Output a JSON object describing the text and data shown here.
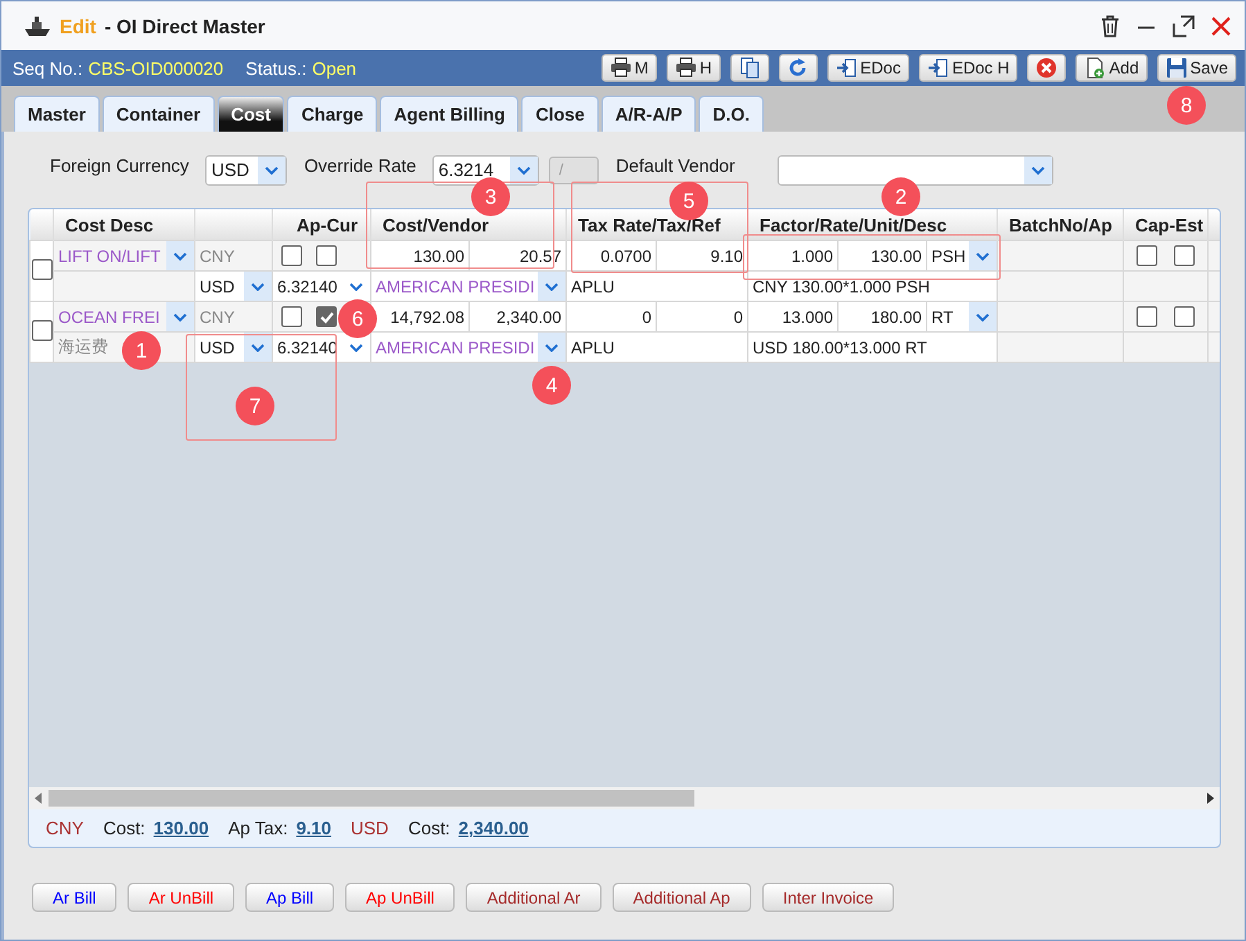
{
  "window": {
    "mode": "Edit",
    "title": "- OI Direct Master"
  },
  "info_bar": {
    "fields": [
      {
        "label": "Seq No.:",
        "value": "CBS-OID000020"
      },
      {
        "label": "Status.:",
        "value": "Open"
      }
    ],
    "buttons": [
      {
        "kind": "print",
        "label": "M"
      },
      {
        "kind": "print",
        "label": "H"
      },
      {
        "kind": "copy"
      },
      {
        "kind": "refresh"
      },
      {
        "kind": "import",
        "label": "EDoc"
      },
      {
        "kind": "import",
        "label": "EDoc H"
      },
      {
        "kind": "delete"
      },
      {
        "kind": "add",
        "label": "Add"
      },
      {
        "kind": "save",
        "label": "Save"
      }
    ]
  },
  "tabs": [
    {
      "label": "Master",
      "selected": false
    },
    {
      "label": "Container",
      "selected": false
    },
    {
      "label": "Cost",
      "selected": true
    },
    {
      "label": "Charge",
      "selected": false
    },
    {
      "label": "Agent Billing",
      "selected": false
    },
    {
      "label": "Close",
      "selected": false
    },
    {
      "label": "A/R-A/P",
      "selected": false
    },
    {
      "label": "D.O.",
      "selected": false
    }
  ],
  "form": {
    "foreign_currency": {
      "label": "Foreign Currency",
      "value": "USD"
    },
    "override_rate": {
      "label": "Override Rate",
      "value": "6.3214",
      "extra": "/"
    },
    "default_vendor": {
      "label": "Default Vendor"
    }
  },
  "table": {
    "columns": [
      "Cost Desc",
      "Ap-Cur",
      "Cost/Vendor",
      "Tax Rate/Tax/Ref",
      "Factor/Rate/Unit/Desc",
      "BatchNo/Ap",
      "Cap-Est"
    ],
    "rows": [
      {
        "selected": false,
        "cost_desc": "LIFT ON/LIFT",
        "local_name": "",
        "currency": "CNY",
        "check_1": false,
        "check_2": false,
        "ap_currency": "USD",
        "rate": "6.32140",
        "cost": "130.00",
        "amount": "20.57",
        "vendor": "AMERICAN PRESIDI",
        "tax_rate": "0.0700",
        "tax": "9.10",
        "ref": "APLU",
        "factor": "1.000",
        "unit_rate": "130.00",
        "unit": "PSH",
        "desc": "CNY 130.00*1.000 PSH",
        "cap": false,
        "est": false
      },
      {
        "selected": false,
        "cost_desc": "OCEAN FREI",
        "local_name": "海运费",
        "currency": "CNY",
        "check_1": false,
        "check_2": true,
        "ap_currency": "USD",
        "rate": "6.32140",
        "cost": "14,792.08",
        "amount": "2,340.00",
        "vendor": "AMERICAN PRESIDI",
        "tax_rate": "0",
        "tax": "0",
        "ref": "APLU",
        "factor": "13.000",
        "unit_rate": "180.00",
        "unit": "RT",
        "desc": "USD 180.00*13.000 RT",
        "cap": false,
        "est": false
      }
    ]
  },
  "totals": [
    {
      "currency": "CNY",
      "items": [
        {
          "label": "Cost:",
          "value": "130.00"
        },
        {
          "label": "Ap Tax:",
          "value": "9.10"
        }
      ]
    },
    {
      "currency": "USD",
      "items": [
        {
          "label": "Cost:",
          "value": "2,340.00"
        }
      ]
    }
  ],
  "bottom_buttons": [
    {
      "label": "Ar Bill",
      "color": "#0000ff"
    },
    {
      "label": "Ar UnBill",
      "color": "#ff0000"
    },
    {
      "label": "Ap Bill",
      "color": "#0000ff"
    },
    {
      "label": "Ap UnBill",
      "color": "#ff0000"
    },
    {
      "label": "Additional Ar",
      "color": "#a52a2a"
    },
    {
      "label": "Additional Ap",
      "color": "#a52a2a"
    },
    {
      "label": "Inter Invoice",
      "color": "#a52a2a"
    }
  ],
  "callouts": [
    {
      "number": "8"
    },
    {
      "number": "3",
      "boxed": true
    },
    {
      "number": "5",
      "boxed": true
    },
    {
      "number": "2",
      "boxed": true
    },
    {
      "number": "6"
    },
    {
      "number": "1"
    },
    {
      "number": "4"
    },
    {
      "number": "7",
      "boxed": true
    }
  ]
}
